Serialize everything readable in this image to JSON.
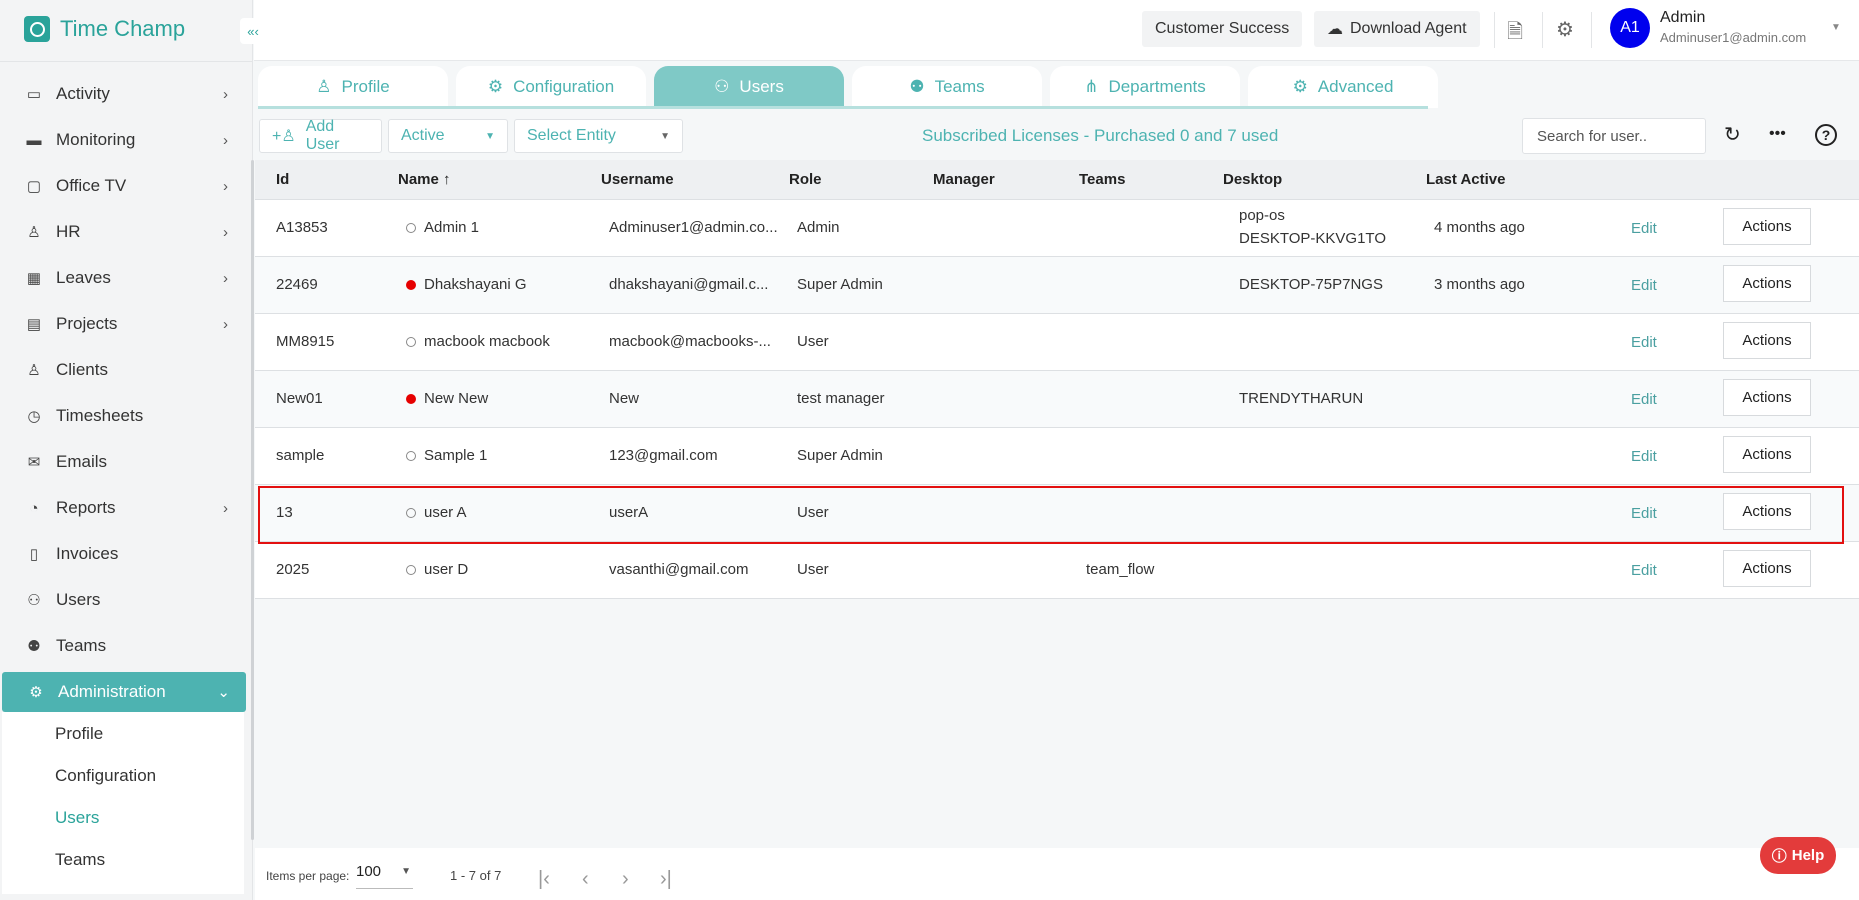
{
  "app": {
    "name": "Time Champ",
    "collapse_icon": "«‹"
  },
  "sidebar": {
    "items": [
      {
        "label": "Activity",
        "icon": "▭",
        "chev": "›"
      },
      {
        "label": "Monitoring",
        "icon": "▬",
        "chev": "›"
      },
      {
        "label": "Office TV",
        "icon": "▢",
        "chev": "›"
      },
      {
        "label": "HR",
        "icon": "♙",
        "chev": "›"
      },
      {
        "label": "Leaves",
        "icon": "▦",
        "chev": "›"
      },
      {
        "label": "Projects",
        "icon": "▤",
        "chev": "›"
      },
      {
        "label": "Clients",
        "icon": "♙",
        "chev": ""
      },
      {
        "label": "Timesheets",
        "icon": "◷",
        "chev": ""
      },
      {
        "label": "Emails",
        "icon": "✉",
        "chev": ""
      },
      {
        "label": "Reports",
        "icon": "◔",
        "chev": "›"
      },
      {
        "label": "Invoices",
        "icon": "▯",
        "chev": ""
      },
      {
        "label": "Users",
        "icon": "⚇",
        "chev": ""
      },
      {
        "label": "Teams",
        "icon": "⚉",
        "chev": ""
      }
    ],
    "admin": {
      "label": "Administration",
      "icon": "⚙",
      "chev": "⌄"
    },
    "submenu": [
      "Profile",
      "Configuration",
      "Users",
      "Teams"
    ]
  },
  "header": {
    "customer_success": "Customer Success",
    "download_agent": "Download Agent",
    "user_initials": "A1",
    "user_name": "Admin",
    "user_email": "Adminuser1@admin.com"
  },
  "tabs": [
    "Profile",
    "Configuration",
    "Users",
    "Teams",
    "Departments",
    "Advanced"
  ],
  "toolbar": {
    "add_user": "Add User",
    "status": "Active",
    "entity": "Select Entity",
    "licenses": "Subscribed Licenses - Purchased 0 and 7 used",
    "search_placeholder": "Search for user.."
  },
  "table": {
    "headers": [
      "Id",
      "Name ↑",
      "Username",
      "Role",
      "Manager",
      "Teams",
      "Desktop",
      "Last Active"
    ],
    "edit_label": "Edit",
    "actions_label": "Actions",
    "rows": [
      {
        "id": "A13853",
        "name": "Admin 1",
        "online": false,
        "username": "Adminuser1@admin.co...",
        "role": "Admin",
        "manager": "",
        "teams": "",
        "desktop": "pop-os",
        "desktop2": "DESKTOP-KKVG1TO",
        "last_active": "4 months ago"
      },
      {
        "id": "22469",
        "name": "Dhakshayani G",
        "online": true,
        "username": "dhakshayani@gmail.c...",
        "role": "Super Admin",
        "manager": "",
        "teams": "",
        "desktop": "DESKTOP-75P7NGS",
        "desktop2": "",
        "last_active": "3 months ago"
      },
      {
        "id": "MM8915",
        "name": "macbook macbook",
        "online": false,
        "username": "macbook@macbooks-...",
        "role": "User",
        "manager": "",
        "teams": "",
        "desktop": "",
        "desktop2": "",
        "last_active": ""
      },
      {
        "id": "New01",
        "name": "New New",
        "online": true,
        "username": "New",
        "role": "test manager",
        "manager": "",
        "teams": "",
        "desktop": "TRENDYTHARUN",
        "desktop2": "",
        "last_active": ""
      },
      {
        "id": "sample",
        "name": "Sample 1",
        "online": false,
        "username": "123@gmail.com",
        "role": "Super Admin",
        "manager": "",
        "teams": "",
        "desktop": "",
        "desktop2": "",
        "last_active": ""
      },
      {
        "id": "13",
        "name": "user A",
        "online": false,
        "username": "userA",
        "role": "User",
        "manager": "",
        "teams": "",
        "desktop": "",
        "desktop2": "",
        "last_active": ""
      },
      {
        "id": "2025",
        "name": "user D",
        "online": false,
        "username": "vasanthi@gmail.com",
        "role": "User",
        "manager": "",
        "teams": "team_flow",
        "desktop": "",
        "desktop2": "",
        "last_active": ""
      }
    ]
  },
  "footer": {
    "items_per_page_label": "Items per page:",
    "items_per_page": "100",
    "range": "1 - 7 of 7"
  },
  "help": "Help"
}
